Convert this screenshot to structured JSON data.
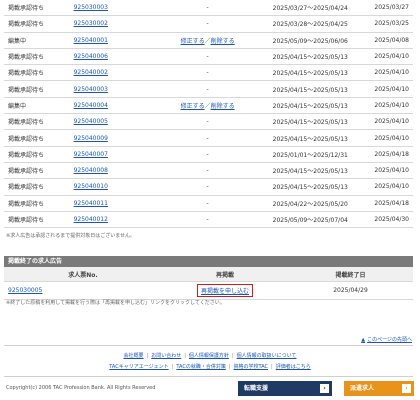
{
  "listing": {
    "rows": [
      {
        "status": "掲載承認待ち",
        "number": "925030003",
        "edit": "",
        "delete": "",
        "period": "2025/03/27～2025/04/24",
        "date": "2025/03/27"
      },
      {
        "status": "掲載承認待ち",
        "number": "925030002",
        "edit": "",
        "delete": "",
        "period": "2025/03/28～2025/04/25",
        "date": "2025/03/25"
      },
      {
        "status": "編集中",
        "number": "925040001",
        "edit": "修正する",
        "delete": "削除する",
        "period": "2025/05/09～2025/06/06",
        "date": "2025/04/08"
      },
      {
        "status": "掲載承認待ち",
        "number": "925040006",
        "edit": "",
        "delete": "",
        "period": "2025/04/15～2025/05/13",
        "date": "2025/04/10"
      },
      {
        "status": "掲載承認待ち",
        "number": "925040002",
        "edit": "",
        "delete": "",
        "period": "2025/04/15～2025/05/13",
        "date": "2025/04/10"
      },
      {
        "status": "掲載承認待ち",
        "number": "925040003",
        "edit": "",
        "delete": "",
        "period": "2025/04/15～2025/05/13",
        "date": "2025/04/10"
      },
      {
        "status": "編集中",
        "number": "925040004",
        "edit": "修正する",
        "delete": "削除する",
        "period": "2025/04/15～2025/05/13",
        "date": "2025/04/10"
      },
      {
        "status": "掲載承認待ち",
        "number": "925040005",
        "edit": "",
        "delete": "",
        "period": "2025/04/15～2025/05/13",
        "date": "2025/04/10"
      },
      {
        "status": "掲載承認待ち",
        "number": "925040009",
        "edit": "",
        "delete": "",
        "period": "2025/04/15～2025/05/13",
        "date": "2025/04/10"
      },
      {
        "status": "掲載承認待ち",
        "number": "925040007",
        "edit": "",
        "delete": "",
        "period": "2025/01/01～2025/12/31",
        "date": "2025/04/18"
      },
      {
        "status": "掲載承認待ち",
        "number": "925040008",
        "edit": "",
        "delete": "",
        "period": "2025/04/15～2025/05/13",
        "date": "2025/04/10"
      },
      {
        "status": "掲載承認待ち",
        "number": "925040010",
        "edit": "",
        "delete": "",
        "period": "2025/04/15～2025/05/13",
        "date": "2025/04/10"
      },
      {
        "status": "掲載承認待ち",
        "number": "925040011",
        "edit": "",
        "delete": "",
        "period": "2025/04/22～2025/05/20",
        "date": "2025/04/18"
      },
      {
        "status": "掲載承認待ち",
        "number": "925040012",
        "edit": "",
        "delete": "",
        "period": "2025/05/09～2025/07/04",
        "date": "2025/04/30"
      }
    ],
    "dash": "-",
    "slash": "／",
    "note": "※求人広告は承認されるまで提供対象日はございません。"
  },
  "ended": {
    "title": "掲載終了の求人広告",
    "headers": {
      "number": "求人票No.",
      "repost": "再掲載",
      "end_date": "掲載終了日"
    },
    "rows": [
      {
        "number": "925030005",
        "repost_label": "再掲載を申し込む",
        "end_date": "2025/04/29"
      }
    ],
    "note": "※終了した原稿を利用して掲載を行う際は「再掲載を申し込む」リンクをクリックしてください。"
  },
  "back_to_top": "このページの先頭へ",
  "footer": {
    "links_row1": [
      "会社概要",
      "お問い合わせ",
      "個人情報保護方針",
      "個人情報の取扱いについて"
    ],
    "links_row2": [
      "TACキャリアエージェント",
      "TACの就職・合併対策",
      "資格の学校TAC",
      "評価者はこちら"
    ],
    "copyright": "Copyright(c) 2006 TAC Profession Bank. All Rights Reserved",
    "button_dark": "転職支援",
    "button_orange": "派遣求人"
  },
  "colors": {
    "link": "#1a56b8",
    "highlight_border": "#d21a1a",
    "button_dark": "#1f3b63",
    "button_orange": "#e8931c",
    "section_bar": "#7a7a7a"
  }
}
